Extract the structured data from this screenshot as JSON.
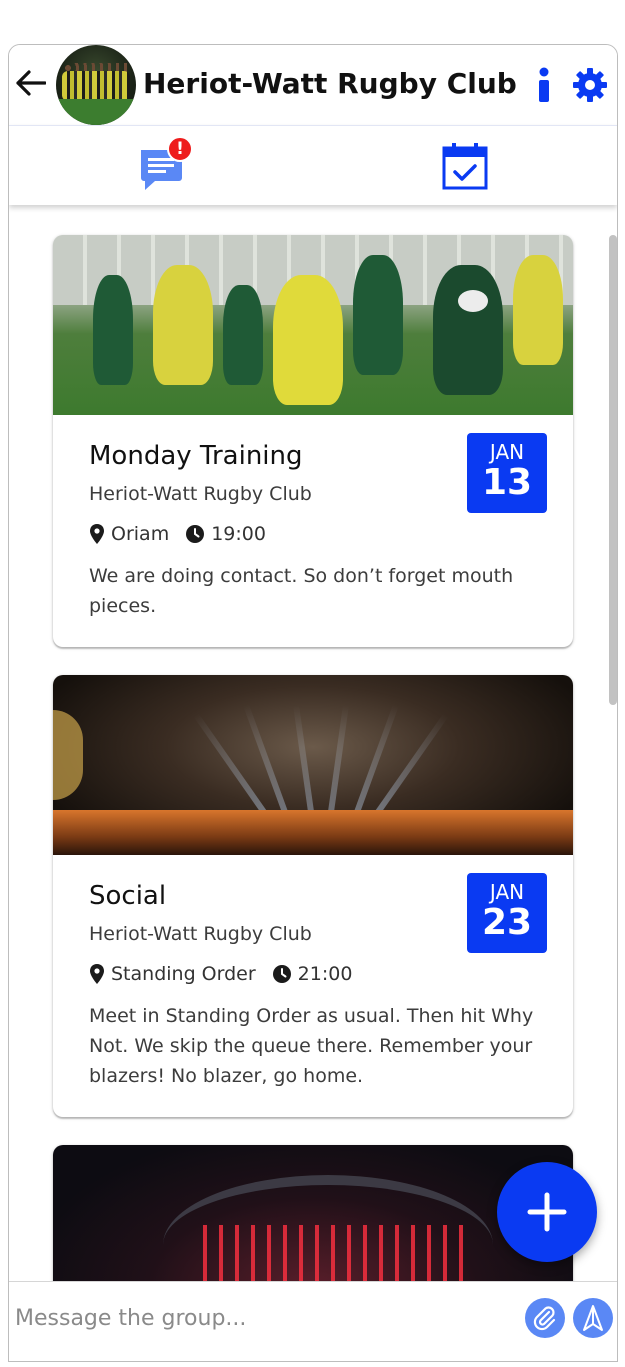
{
  "header": {
    "title": "Heriot-Watt Rugby Club",
    "back_icon": "arrow-left-icon",
    "info_icon": "info-icon",
    "settings_icon": "gear-icon"
  },
  "tabs": [
    {
      "name": "chat",
      "icon": "chat-bubble-icon",
      "badge": "!"
    },
    {
      "name": "events",
      "icon": "calendar-check-icon"
    }
  ],
  "events": [
    {
      "title": "Monday Training",
      "club": "Heriot-Watt Rugby Club",
      "location": "Oriam",
      "time": "19:00",
      "description": "We are doing contact. So don’t forget mouth pieces.",
      "month": "JAN",
      "day": "13"
    },
    {
      "title": "Social",
      "club": "Heriot-Watt Rugby Club",
      "location": "Standing Order",
      "time": "21:00",
      "description": "Meet in Standing Order as usual. Then hit Why Not. We skip the queue there. Remember your blazers! No blazer, go home.",
      "month": "JAN",
      "day": "23"
    }
  ],
  "composer": {
    "placeholder": "Message the group...",
    "attach_icon": "paperclip-icon",
    "send_icon": "send-arrow-icon"
  },
  "fab": {
    "icon": "plus-icon"
  },
  "colors": {
    "accent": "#0a3af2",
    "badge": "#ee1c1c",
    "chat_icon": "#5a88f5"
  }
}
